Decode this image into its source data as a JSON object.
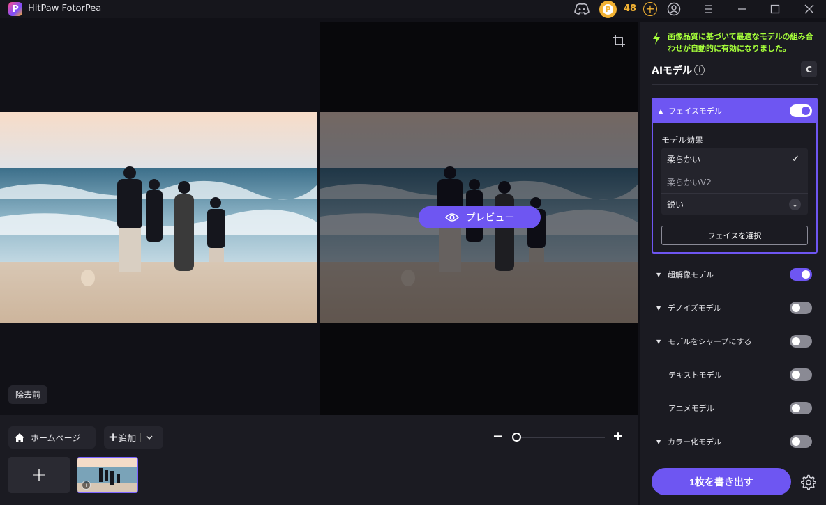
{
  "window": {
    "app_title": "HitPaw FotorPea",
    "credits": "48",
    "coin_glyph": "P"
  },
  "icons": {
    "logo": "app-logo-icon",
    "discord": "discord-icon",
    "coin": "coin-icon",
    "add_credits": "plus-circle-icon",
    "account": "user-circle-icon",
    "menu": "hamburger-menu-icon",
    "minimize": "minimize-icon",
    "maximize": "maximize-icon",
    "close": "close-icon",
    "crop": "crop-icon",
    "eye": "eye-icon",
    "home": "home-icon",
    "chevron": "chevron-down-icon",
    "bolt": "lightning-bolt-icon",
    "info": "info-icon",
    "refresh": "refresh-icon",
    "check": "check-icon",
    "download": "download-icon",
    "settings": "gear-icon"
  },
  "canvas": {
    "preview_label": "プレビュー",
    "before_label": "除去前"
  },
  "bottom_bar": {
    "home_label": "ホームページ",
    "add_label": "追加",
    "add_plus": "+",
    "zoom_minus": "−",
    "zoom_plus": "+",
    "zoom_level": 0,
    "add_tile_glyph": "+",
    "thumb_info_glyph": "i"
  },
  "panel": {
    "notice": "画像品質に基づいて最適なモデルの組み合わせが自動的に有効になりました。",
    "ai_title": "AIモデル",
    "info_glyph": "i",
    "refresh_glyph": "C",
    "face_model": {
      "label": "フェイスモデル",
      "enabled": true,
      "effect_title": "モデル効果",
      "effects": [
        {
          "label": "柔らかい",
          "state": "selected"
        },
        {
          "label": "柔らかいV2",
          "state": "available"
        },
        {
          "label": "鋭い",
          "state": "download"
        }
      ],
      "select_face_label": "フェイスを選択"
    },
    "models": [
      {
        "label": "超解像モデル",
        "enabled": true,
        "sub": false
      },
      {
        "label": "デノイズモデル",
        "enabled": false,
        "sub": false
      },
      {
        "label": "モデルをシャープにする",
        "enabled": false,
        "sub": false
      },
      {
        "label": "テキストモデル",
        "enabled": false,
        "sub": true
      },
      {
        "label": "アニメモデル",
        "enabled": false,
        "sub": true
      },
      {
        "label": "カラー化モデル",
        "enabled": false,
        "sub": false
      }
    ],
    "export_label": "1枚を書き出す"
  },
  "colors": {
    "accent": "#6e56f2",
    "notice": "#a6ff3a",
    "coin": "#f2b233"
  }
}
